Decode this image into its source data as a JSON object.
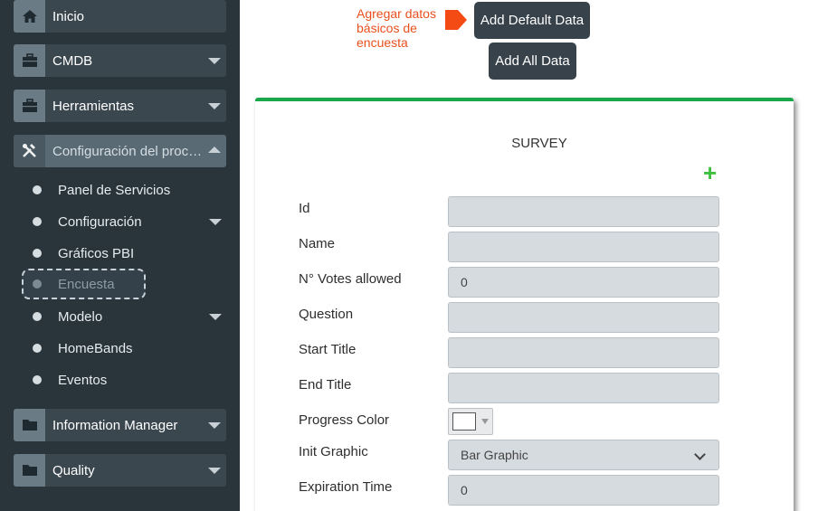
{
  "sidebar": {
    "menu": [
      {
        "label": "Inicio",
        "icon": "home-icon"
      },
      {
        "label": "CMDB",
        "icon": "briefcase-icon"
      },
      {
        "label": "Herramientas",
        "icon": "briefcase-icon"
      },
      {
        "label": "Configuración del proceso",
        "icon": "tools-icon"
      },
      {
        "label": "Information Manager",
        "icon": "folder-icon"
      },
      {
        "label": "Quality",
        "icon": "folder-icon"
      }
    ],
    "submenu": [
      {
        "label": "Panel de Servicios"
      },
      {
        "label": "Configuración"
      },
      {
        "label": "Gráficos PBI"
      },
      {
        "label": "Encuesta"
      },
      {
        "label": "Modelo"
      },
      {
        "label": "HomeBands"
      },
      {
        "label": "Eventos"
      }
    ]
  },
  "annotation": {
    "line1": "Agregar datos",
    "line2": "básicos de",
    "line3": "encuesta",
    "color": "#e8501d"
  },
  "buttons": {
    "add_default": "Add Default Data",
    "add_all": "Add All Data"
  },
  "form": {
    "title": "SURVEY",
    "add_icon": "plus-icon",
    "accent": "#1aa64a",
    "fields": [
      {
        "label": "Id",
        "value": ""
      },
      {
        "label": "Name",
        "value": ""
      },
      {
        "label": "N° Votes allowed",
        "value": "0"
      },
      {
        "label": "Question",
        "value": ""
      },
      {
        "label": "Start Title",
        "value": ""
      },
      {
        "label": "End Title",
        "value": ""
      },
      {
        "label": "Progress Color",
        "value": "#ffffff"
      },
      {
        "label": "Init Graphic",
        "value": "Bar Graphic"
      },
      {
        "label": "Expiration Time",
        "value": "0"
      }
    ]
  }
}
